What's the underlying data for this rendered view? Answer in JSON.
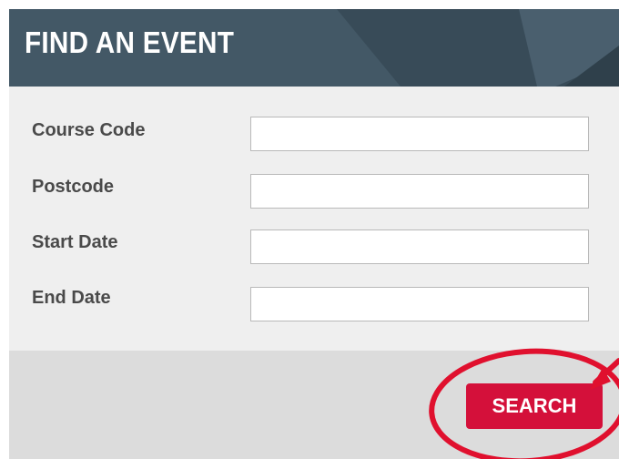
{
  "header": {
    "title": "FIND AN EVENT"
  },
  "form": {
    "fields": [
      {
        "label": "Course Code",
        "value": ""
      },
      {
        "label": "Postcode",
        "value": ""
      },
      {
        "label": "Start Date",
        "value": ""
      },
      {
        "label": "End Date",
        "value": ""
      }
    ]
  },
  "footer": {
    "search_label": "SEARCH"
  },
  "colors": {
    "header_bg": "#435866",
    "form_bg": "#efefef",
    "footer_bg": "#dcdcdc",
    "button_bg": "#d4103a",
    "annotation": "#e0102e"
  }
}
